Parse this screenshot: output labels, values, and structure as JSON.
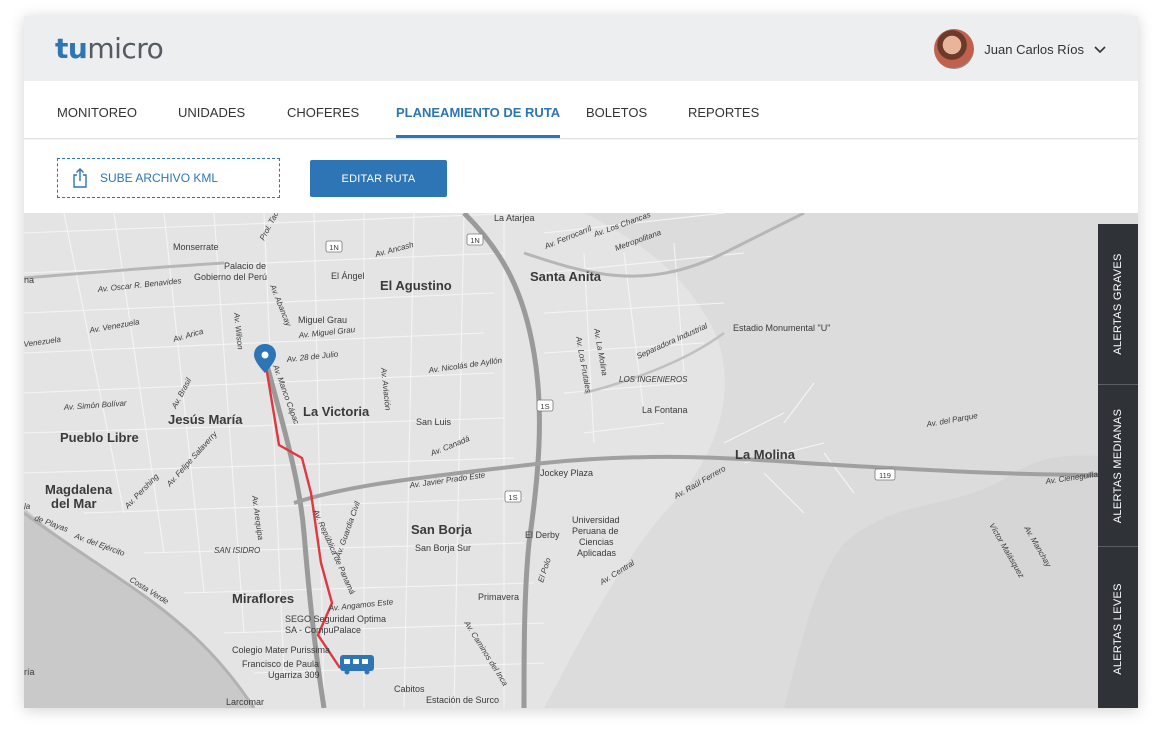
{
  "app": {
    "logo_part1": "tu",
    "logo_part2": "micro",
    "brand_color": "#2e75b6"
  },
  "user": {
    "name": "Juan Carlos Ríos",
    "menu_icon": "chevron-down-icon"
  },
  "nav": {
    "tabs": [
      {
        "label": "MONITOREO",
        "active": false
      },
      {
        "label": "UNIDADES",
        "active": false
      },
      {
        "label": "CHOFERES",
        "active": false
      },
      {
        "label": "PLANEAMIENTO DE RUTA",
        "active": true
      },
      {
        "label": "BOLETOS",
        "active": false
      },
      {
        "label": "REPORTES",
        "active": false
      }
    ]
  },
  "toolbar": {
    "upload_label": "SUBE ARCHIVO KML",
    "upload_icon": "upload-icon",
    "edit_label": "EDITAR RUTA"
  },
  "alerts": {
    "graves": "ALERTAS GRAVES",
    "medianas": "ALERTAS MEDIANAS",
    "leves": "ALERTAS LEVES"
  },
  "map": {
    "route_color": "#e0383e",
    "labels": {
      "la_atarjea": "La Atarjea",
      "monserrate": "Monserrate",
      "palacio": "Palacio de",
      "gobierno": "Gobierno del Perú",
      "el_angel": "El Ángel",
      "el_agustino": "El Agustino",
      "santa_anita": "Santa Anita",
      "av_ancash": "Av. Ancash",
      "av_ferrocarril": "Av. Ferrocarril",
      "av_los_chancas": "Av. Los Chancas",
      "metropolitana": "Metropolitana",
      "av_oscar": "Av. Oscar R. Benavides",
      "miguel_grau": "Miguel Grau",
      "av_miguel_grau": "Av. Miguel Grau",
      "av_28": "Av. 28 de Julio",
      "av_venezuela": "Av. Venezuela",
      "venezuela": "Venezuela",
      "av_arica": "Av. Arica",
      "av_nicolas": "Av. Nicolás de Ayllón",
      "estadio": "Estadio Monumental \"U\"",
      "separadora": "Separadora Industrial",
      "los_ingenieros": "LOS INGENIEROS",
      "la_fontana": "La Fontana",
      "av_simon": "Av. Simón Bolívar",
      "jesus_maria": "Jesús María",
      "la_victoria": "La Victoria",
      "san_luis": "San Luis",
      "pueblo_libre": "Pueblo Libre",
      "av_canada": "Av. Canadá",
      "av_javier": "Av. Javier Prado Este",
      "jockey": "Jockey Plaza",
      "la_molina": "La Molina",
      "av_del_parque": "Av. del Parque",
      "av_raul": "Av. Raúl Ferrero",
      "magdalena": "Magdalena",
      "del_mar": "del Mar",
      "san_borja": "San Borja",
      "san_borja_sur": "San Borja Sur",
      "el_derby": "El Derby",
      "universidad": "Universidad",
      "peruana": "Peruana de",
      "ciencias": "Ciencias",
      "aplicadas": "Aplicadas",
      "san_isidro": "SAN ISIDRO",
      "av_del_ejercito": "Av. del Ejército",
      "costa_verde": "Costa Verde",
      "miraflores": "Miraflores",
      "av_angamos": "Av. Angamos Este",
      "primavera": "Primavera",
      "sego": "SEGO Seguridad Optima",
      "compu": "SA - CompuPalace",
      "colegio": "Colegio Mater Purissima",
      "francisco": "Francisco de Paula",
      "ugarriza": "Ugarriza 309",
      "cabitos": "Cabitos",
      "estacion": "Estación de Surco",
      "larcomar": "Larcomar",
      "av_central": "Av. Central",
      "el_polo": "El Polo",
      "av_cieneguilla": "Av. Cieneguilla",
      "av_manchay": "Av. Manchay",
      "victor": "Víctor Malásquez",
      "av_brasil": "Av. Brasil",
      "av_aviacion": "Av. Aviación",
      "av_la_molina": "Av. La Molina",
      "av_los_frutales": "Av. Los Frutales",
      "av_pershing": "Av. Pershing",
      "av_arequipa": "Av. Arequipa",
      "av_salaverry": "Av. Felipe Salaverry",
      "av_republica": "Av. República de Panamá",
      "av_guardia": "Av. Guardia Civil",
      "av_wilson": "Av. Wilson",
      "av_abancay": "Av. Abancay",
      "prol_tacna": "Prol. Tacna",
      "av_caminos": "Av. Caminos del Inca",
      "manco_capac": "Av. Manco Cápac",
      "de_playas": "de Playas",
      "playas_lead": "la",
      "edge_na": "na",
      "edge_ria": "ría",
      "road_1n": "1N",
      "road_1s": "1S",
      "road_119": "119"
    }
  }
}
